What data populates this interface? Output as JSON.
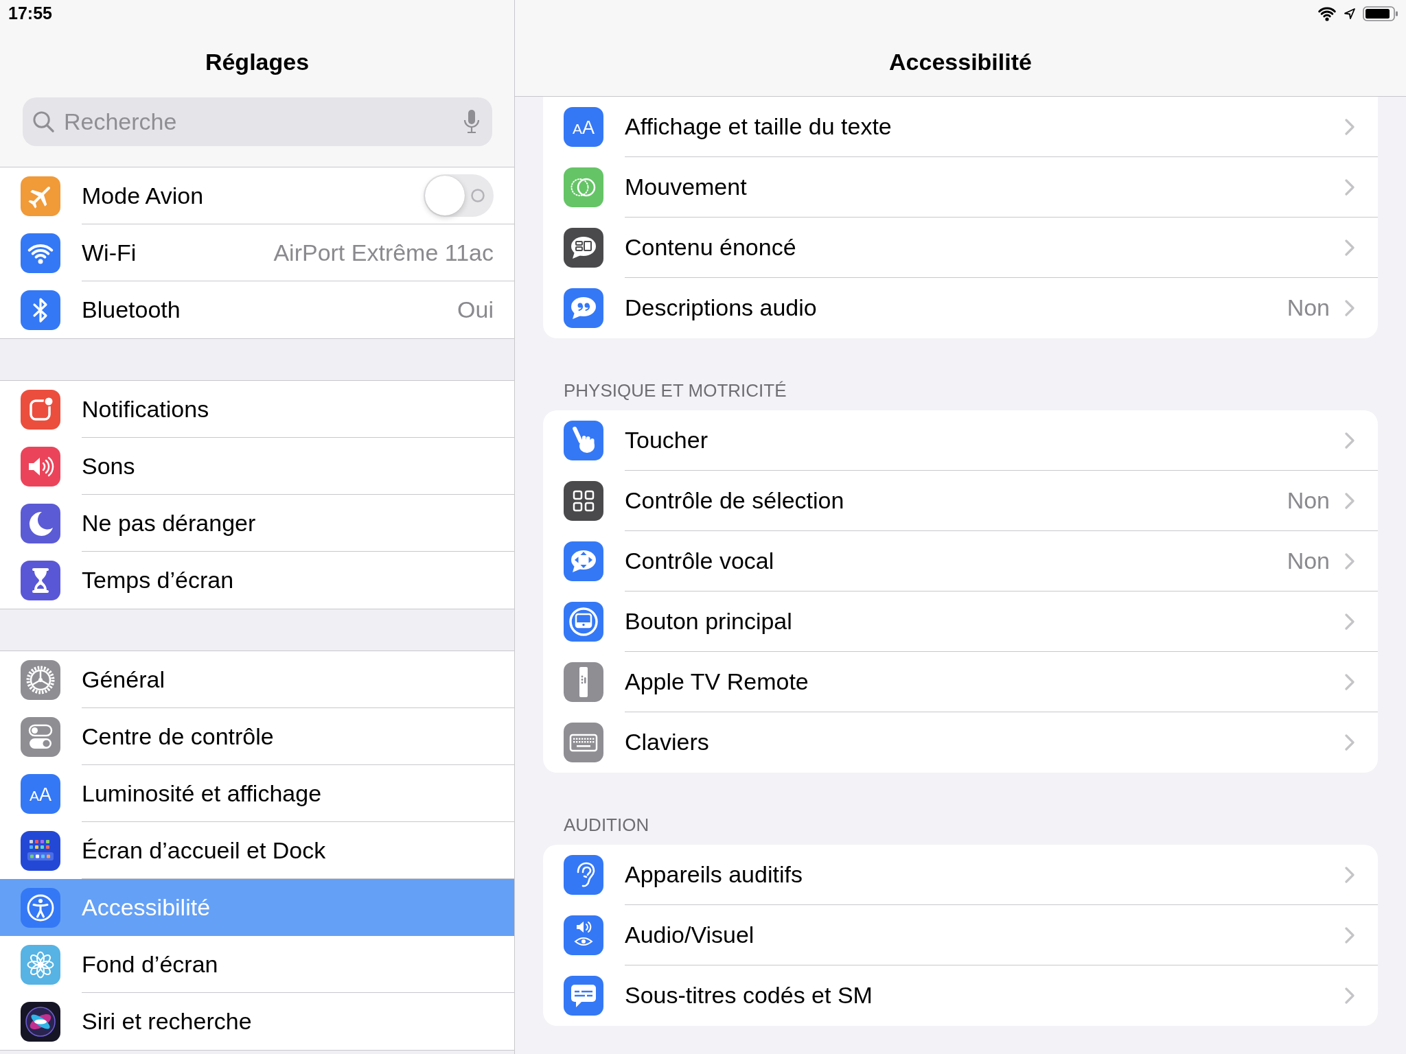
{
  "status_bar": {
    "time": "17:55"
  },
  "sidebar": {
    "title": "Réglages",
    "search": {
      "placeholder": "Recherche"
    },
    "groups": [
      {
        "items": [
          {
            "kind": "toggle",
            "label": "Mode Avion",
            "on": false,
            "selected": false
          },
          {
            "kind": "link",
            "label": "Wi-Fi",
            "value": "AirPort Extrême 11ac",
            "selected": false
          },
          {
            "kind": "link",
            "label": "Bluetooth",
            "value": "Oui",
            "selected": false
          }
        ]
      },
      {
        "items": [
          {
            "kind": "link",
            "label": "Notifications",
            "selected": false
          },
          {
            "kind": "link",
            "label": "Sons",
            "selected": false
          },
          {
            "kind": "link",
            "label": "Ne pas déranger",
            "selected": false
          },
          {
            "kind": "link",
            "label": "Temps d’écran",
            "selected": false
          }
        ]
      },
      {
        "items": [
          {
            "kind": "link",
            "label": "Général",
            "selected": false
          },
          {
            "kind": "link",
            "label": "Centre de contrôle",
            "selected": false
          },
          {
            "kind": "link",
            "label": "Luminosité et affichage",
            "icon_text": "AA",
            "selected": false
          },
          {
            "kind": "link",
            "label": "Écran d’accueil et Dock",
            "selected": false
          },
          {
            "kind": "link",
            "label": "Accessibilité",
            "selected": true
          },
          {
            "kind": "link",
            "label": "Fond d’écran",
            "selected": false
          },
          {
            "kind": "link",
            "label": "Siri et recherche",
            "selected": false
          }
        ]
      }
    ]
  },
  "detail": {
    "title": "Accessibilité",
    "sections": [
      {
        "items": [
          {
            "label": "Affichage et taille du texte",
            "icon_text": "AA"
          },
          {
            "label": "Mouvement"
          },
          {
            "label": "Contenu énoncé"
          },
          {
            "label": "Descriptions audio",
            "value": "Non"
          }
        ]
      },
      {
        "header": "PHYSIQUE ET MOTRICITÉ",
        "items": [
          {
            "label": "Toucher"
          },
          {
            "label": "Contrôle de sélection",
            "value": "Non"
          },
          {
            "label": "Contrôle vocal",
            "value": "Non"
          },
          {
            "label": "Bouton principal"
          },
          {
            "label": "Apple TV Remote"
          },
          {
            "label": "Claviers"
          }
        ]
      },
      {
        "header": "AUDITION",
        "items": [
          {
            "label": "Appareils auditifs"
          },
          {
            "label": "Audio/Visuel"
          },
          {
            "label": "Sous-titres codés et SM"
          }
        ]
      }
    ]
  }
}
